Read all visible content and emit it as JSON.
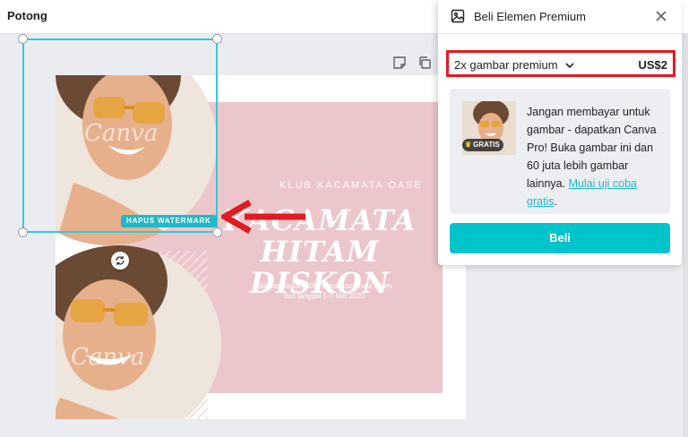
{
  "topbar": {
    "title": "Potong"
  },
  "design": {
    "club_text": "KLUB KACAMATA OASE",
    "headline_line1": "KACAMATA",
    "headline_line2": "HITAM DISKON",
    "subtext_line1": "Nikmati diskon 50% untuk kacamata hitam",
    "subtext_line2": "dari tanggal 1-7 Mei 2020",
    "watermark": "Canva",
    "remove_watermark_label": "HAPUS WATERMARK"
  },
  "panel": {
    "title": "Beli Elemen Premium",
    "select_value": "2x gambar premium",
    "price": "US$2",
    "badge": "GRATIS",
    "info_text": "Jangan membayar untuk gambar - dapatkan Canva Pro! Buka gambar ini dan 60 juta lebih gambar lainnya.",
    "trial_link": "Mulai uji coba gratis",
    "trial_suffix": ".",
    "buy_label": "Beli"
  },
  "colors": {
    "accent": "#00c4cc",
    "selection": "#33cad9",
    "highlight_red": "#e01b22",
    "pink": "#ebc7cc"
  }
}
